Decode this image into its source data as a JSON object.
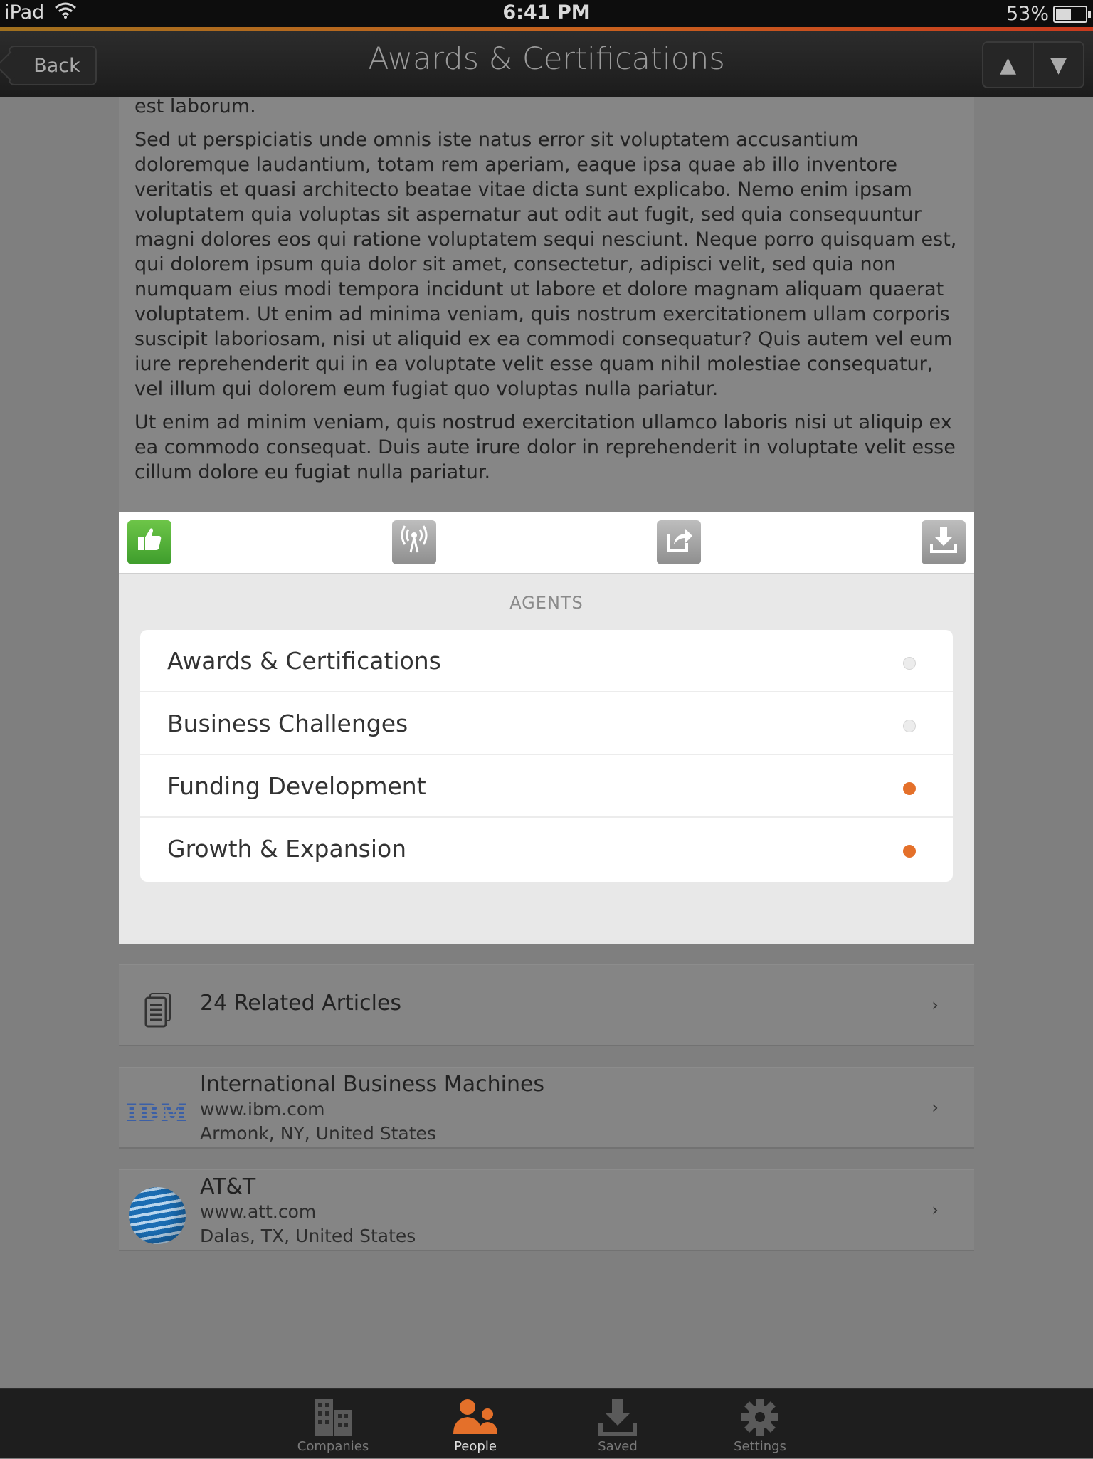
{
  "status_bar": {
    "device": "iPad",
    "time": "6:41 PM",
    "battery": "53%",
    "battery_level": 0.53
  },
  "nav": {
    "back_label": "Back",
    "title": "Awards & Certifications",
    "up_icon": "▲",
    "down_icon": "▼"
  },
  "article": {
    "paragraphs": [
      "est laborum.",
      "Sed ut perspiciatis unde omnis iste natus error sit voluptatem accusantium doloremque laudantium, totam rem aperiam, eaque ipsa quae ab illo inventore veritatis et quasi architecto beatae vitae dicta sunt explicabo. Nemo enim ipsam voluptatem quia voluptas sit aspernatur aut odit aut fugit, sed quia consequuntur magni dolores eos qui ratione voluptatem sequi nesciunt. Neque porro quisquam est, qui dolorem ipsum quia dolor sit amet, consectetur, adipisci velit, sed quia non numquam eius modi tempora incidunt ut labore et dolore magnam aliquam quaerat voluptatem. Ut enim ad minima veniam, quis nostrum exercitationem ullam corporis suscipit laboriosam, nisi ut aliquid ex ea commodi consequatur? Quis autem vel eum iure reprehenderit qui in ea voluptate velit esse quam nihil molestiae consequatur, vel illum qui dolorem eum fugiat quo voluptas nulla pariatur.",
      "Ut enim ad minim veniam, quis nostrud exercitation ullamco laboris nisi ut aliquip ex ea commodo consequat. Duis aute irure dolor in reprehenderit in voluptate velit esse cillum dolore eu fugiat nulla pariatur."
    ]
  },
  "toolbar": {
    "like_icon": "thumbs-up-icon",
    "broadcast_icon": "broadcast-icon",
    "share_icon": "share-icon",
    "download_icon": "download-icon",
    "like_color": "#4caf35"
  },
  "agents": {
    "title": "AGENTS",
    "items": [
      {
        "label": "Awards & Certifications",
        "active": false
      },
      {
        "label": "Business Challenges",
        "active": false
      },
      {
        "label": "Funding Development",
        "active": true
      },
      {
        "label": "Growth & Expansion",
        "active": true
      }
    ],
    "active_color": "#e4702a"
  },
  "related": {
    "label": "24 Related Articles",
    "icon": "document-icon"
  },
  "companies": [
    {
      "name": "International Business Machines",
      "url": "www.ibm.com",
      "location": "Armonk, NY, United States",
      "logo_text": "IBM"
    },
    {
      "name": "AT&T",
      "url": "www.att.com",
      "location": "Dalas, TX, United States"
    }
  ],
  "tabs": [
    {
      "label": "Companies",
      "icon": "buildings-icon",
      "active": false
    },
    {
      "label": "People",
      "icon": "people-icon",
      "active": true
    },
    {
      "label": "Saved",
      "icon": "saved-download-icon",
      "active": false
    },
    {
      "label": "Settings",
      "icon": "gear-icon",
      "active": false
    }
  ],
  "colors": {
    "accent": "#e4702a",
    "tab_active_icon": "#e4702a"
  }
}
